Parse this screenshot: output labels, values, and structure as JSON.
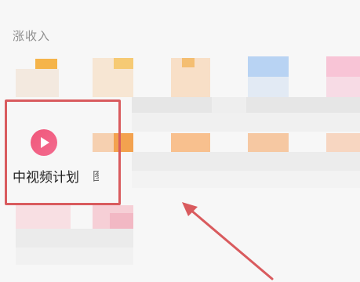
{
  "section": {
    "title": "涨收入"
  },
  "highlighted_item": {
    "label": "中视频计划",
    "icon": "play-icon",
    "cut_char": "图"
  },
  "colors": {
    "highlight": "#d95b5e",
    "icon_gradient_start": "#f0577a",
    "icon_gradient_end": "#f36b8f",
    "arrow": "#d95b5e"
  }
}
